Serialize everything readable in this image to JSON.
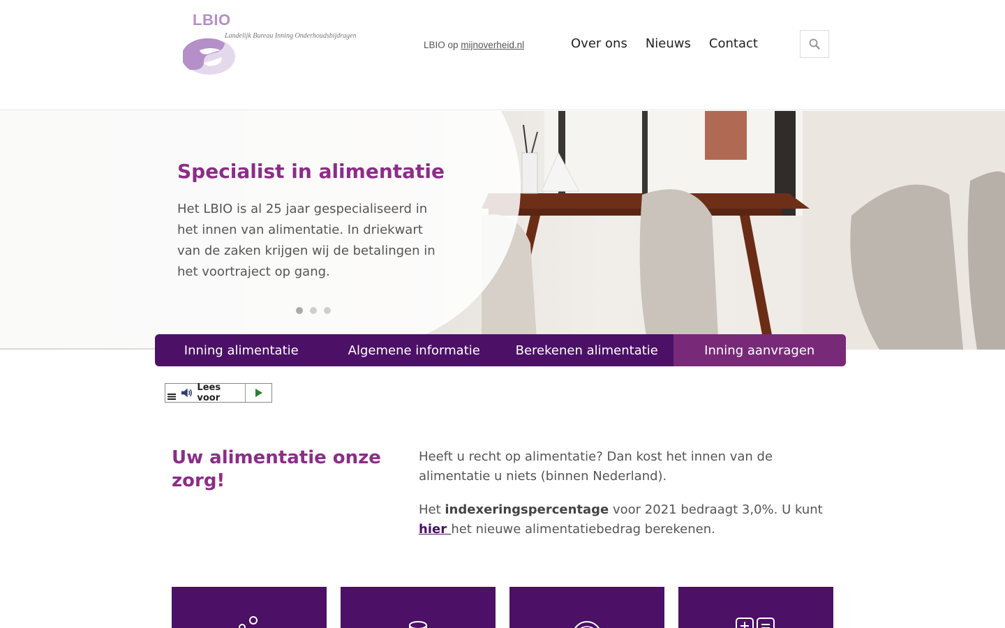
{
  "header": {
    "logo_title": "LBIO",
    "logo_subtitle": "Landelijk Bureau Inning Onderhoudsbijdragen",
    "mijn_prefix": "LBIO op",
    "mijn_link": "mijnoverheid.nl",
    "nav": [
      {
        "label": "Over ons"
      },
      {
        "label": "Nieuws"
      },
      {
        "label": "Contact"
      }
    ],
    "search_icon": "search-icon"
  },
  "hero": {
    "title": "Specialist in alimentatie",
    "text": "Het LBIO is al 25 jaar gespecialiseerd in het innen van alimentatie. In driekwart van de zaken krijgen wij de betalingen in het voortraject op gang.",
    "slides_total": 3,
    "active_slide": 1
  },
  "mainnav": [
    {
      "label": "Inning alimentatie"
    },
    {
      "label": "Algemene informatie"
    },
    {
      "label": "Berekenen alimentatie"
    },
    {
      "label": "Inning aanvragen"
    }
  ],
  "readspeaker": {
    "label": "Lees voor"
  },
  "content": {
    "title": "Uw alimentatie onze zorg!",
    "p1": "Heeft u recht op alimentatie? Dan kost het innen van de alimentatie u niets (binnen Nederland).",
    "p2_prefix": "Het ",
    "p2_bold": "indexeringspercentage",
    "p2_middle": " voor 2021 bedraagt 3,0%. U kunt ",
    "p2_link": "hier ",
    "p2_suffix": "het nieuwe alimentatiebedrag berekenen."
  },
  "colors": {
    "purple_dark": "#4c1067",
    "purple_active": "#782a78",
    "purple_title": "#8b2d88",
    "logo_lilac": "#b48fc8"
  }
}
